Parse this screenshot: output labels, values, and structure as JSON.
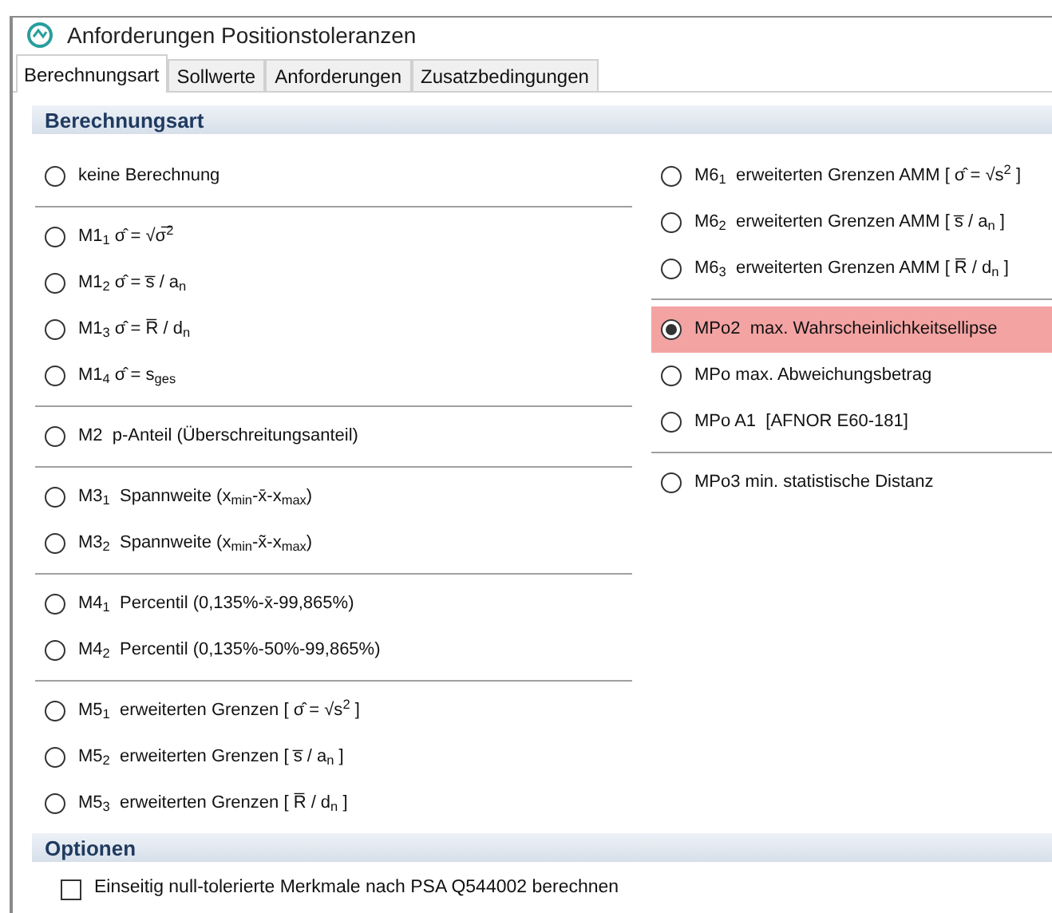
{
  "window": {
    "title": "Anforderungen Positionstoleranzen"
  },
  "tabs": [
    {
      "label": "Berechnungsart",
      "selected": true
    },
    {
      "label": "Sollwerte",
      "selected": false
    },
    {
      "label": "Anforderungen",
      "selected": false
    },
    {
      "label": "Zusatzbedingungen",
      "selected": false
    }
  ],
  "section": {
    "title": "Berechnungsart"
  },
  "columns": [
    [
      [
        {
          "label": "keine Berechnung",
          "selected": false
        }
      ],
      [
        {
          "label": "M1$_{1}$ σ̂ = √σ̅$^{2}$",
          "selected": false
        },
        {
          "label": "M1$_{2}$ σ̂ = s̅ / a$_{n}$",
          "selected": false
        },
        {
          "label": "M1$_{3}$ σ̂ = R̅ / d$_{n}$",
          "selected": false
        },
        {
          "label": "M1$_{4}$ σ̂ = s$_{ges}$",
          "selected": false
        }
      ],
      [
        {
          "label": "M2  p-Anteil (Überschreitungsanteil)",
          "selected": false
        }
      ],
      [
        {
          "label": "M3$_{1}$  Spannweite (x$_{min}$-x̄-x$_{max}$)",
          "selected": false
        },
        {
          "label": "M3$_{2}$  Spannweite (x$_{min}$-x̃-x$_{max}$)",
          "selected": false
        }
      ],
      [
        {
          "label": "M4$_{1}$  Percentil (0,135%-x̄-99,865%)",
          "selected": false
        },
        {
          "label": "M4$_{2}$  Percentil (0,135%-50%-99,865%)",
          "selected": false
        }
      ],
      [
        {
          "label": "M5$_{1}$  erweiterten Grenzen [ σ̂ = √s$^{2}$ ]",
          "selected": false
        },
        {
          "label": "M5$_{2}$  erweiterten Grenzen [ s̅ / a$_{n}$ ]",
          "selected": false
        },
        {
          "label": "M5$_{3}$  erweiterten Grenzen [ R̅ / d$_{n}$ ]",
          "selected": false
        }
      ]
    ],
    [
      [
        {
          "label": "M6$_{1}$  erweiterten Grenzen AMM [ σ̂ = √s$^{2}$ ]",
          "selected": false
        },
        {
          "label": "M6$_{2}$  erweiterten Grenzen AMM [ s̅ / a$_{n}$ ]",
          "selected": false
        },
        {
          "label": "M6$_{3}$  erweiterten Grenzen AMM [ R̅ / d$_{n}$ ]",
          "selected": false
        }
      ],
      [
        {
          "label": "MPo2  max. Wahrscheinlichkeitsellipse",
          "selected": true
        },
        {
          "label": "MPo max. Abweichungsbetrag",
          "selected": false
        },
        {
          "label": "MPo A1  [AFNOR E60-181]",
          "selected": false
        }
      ],
      [
        {
          "label": "MPo3 min. statistische Distanz",
          "selected": false
        }
      ]
    ]
  ],
  "options": {
    "title": "Optionen",
    "items": [
      {
        "label": "Einseitig null-tolerierte Merkmale nach PSA Q544002 berechnen",
        "checked": false
      }
    ]
  }
}
